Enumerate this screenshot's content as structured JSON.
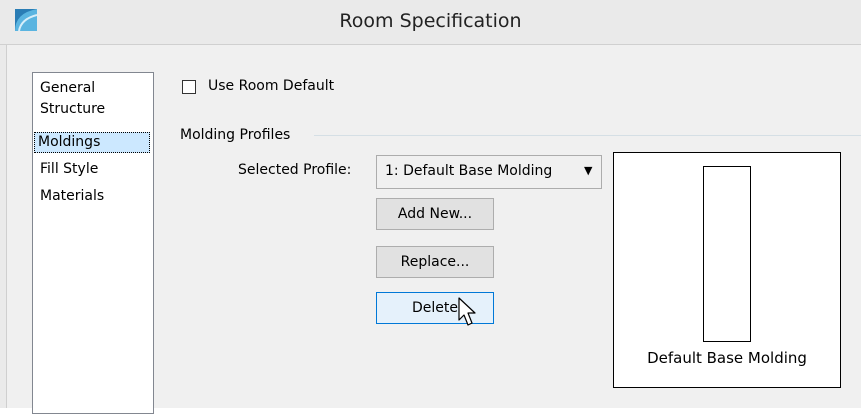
{
  "window": {
    "title": "Room Specification",
    "icon": "app-icon"
  },
  "nav": {
    "items": [
      {
        "label": "General",
        "selected": false
      },
      {
        "label": "Structure",
        "selected": false
      },
      {
        "label": "Moldings",
        "selected": true
      },
      {
        "label": "Fill Style",
        "selected": false
      },
      {
        "label": "Materials",
        "selected": false
      }
    ]
  },
  "use_room_default": {
    "label": "Use Room Default",
    "checked": false
  },
  "molding_profiles": {
    "group_label": "Molding Profiles",
    "selected_profile_label": "Selected Profile:",
    "selected_profile_value": "1:  Default Base Molding",
    "buttons": {
      "add_new": "Add New...",
      "replace": "Replace...",
      "delete": "Delete"
    },
    "preview_label": "Default Base Molding"
  },
  "colors": {
    "selection": "#cce8ff",
    "button_hover": "#e5f1fb",
    "accent": "#0078d7"
  }
}
